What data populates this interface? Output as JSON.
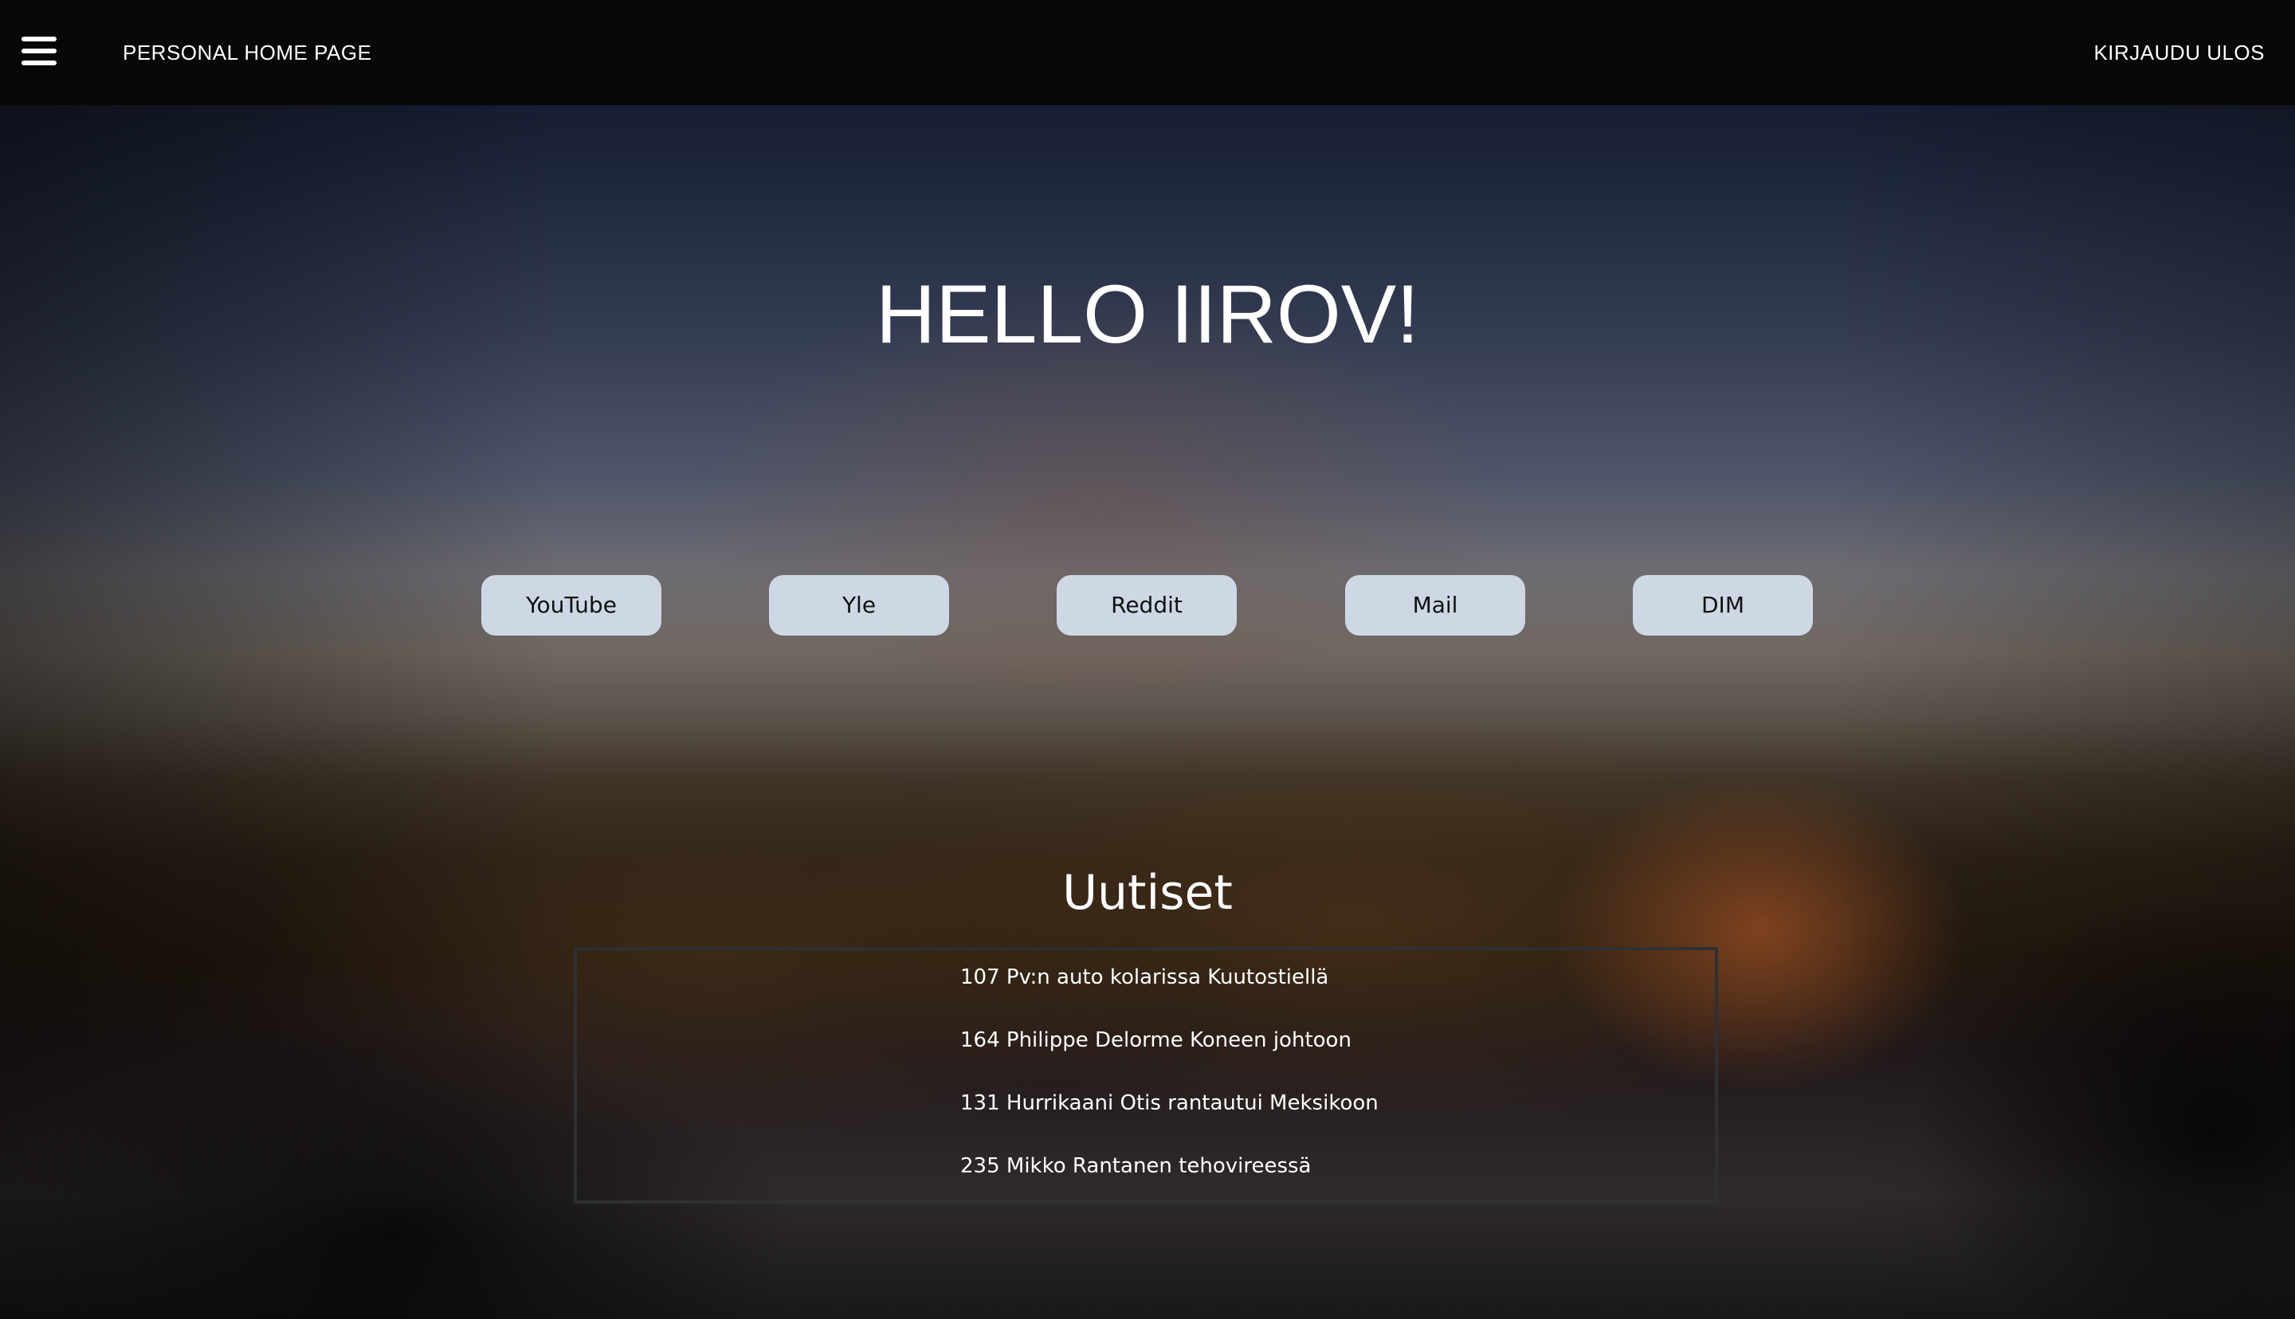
{
  "header": {
    "menu_icon": "hamburger-menu-icon",
    "title": "PERSONAL HOME PAGE",
    "logout_label": "KIRJAUDU ULOS"
  },
  "greeting": "HELLO IIROV!",
  "quick_links": [
    {
      "label": "YouTube"
    },
    {
      "label": "Yle"
    },
    {
      "label": "Reddit"
    },
    {
      "label": "Mail"
    },
    {
      "label": "DIM"
    }
  ],
  "news": {
    "title": "Uutiset",
    "items": [
      {
        "text": "107 Pv:n auto kolarissa Kuutostiellä"
      },
      {
        "text": "164 Philippe Delorme Koneen johtoon"
      },
      {
        "text": "131 Hurrikaani Otis rantautui Meksikoon"
      },
      {
        "text": "235 Mikko Rantanen tehovireessä"
      }
    ]
  },
  "colors": {
    "topbar_bg": "#070706",
    "button_bg": "#cdd8e4",
    "button_text": "#111111",
    "news_border": "#2f3034"
  }
}
